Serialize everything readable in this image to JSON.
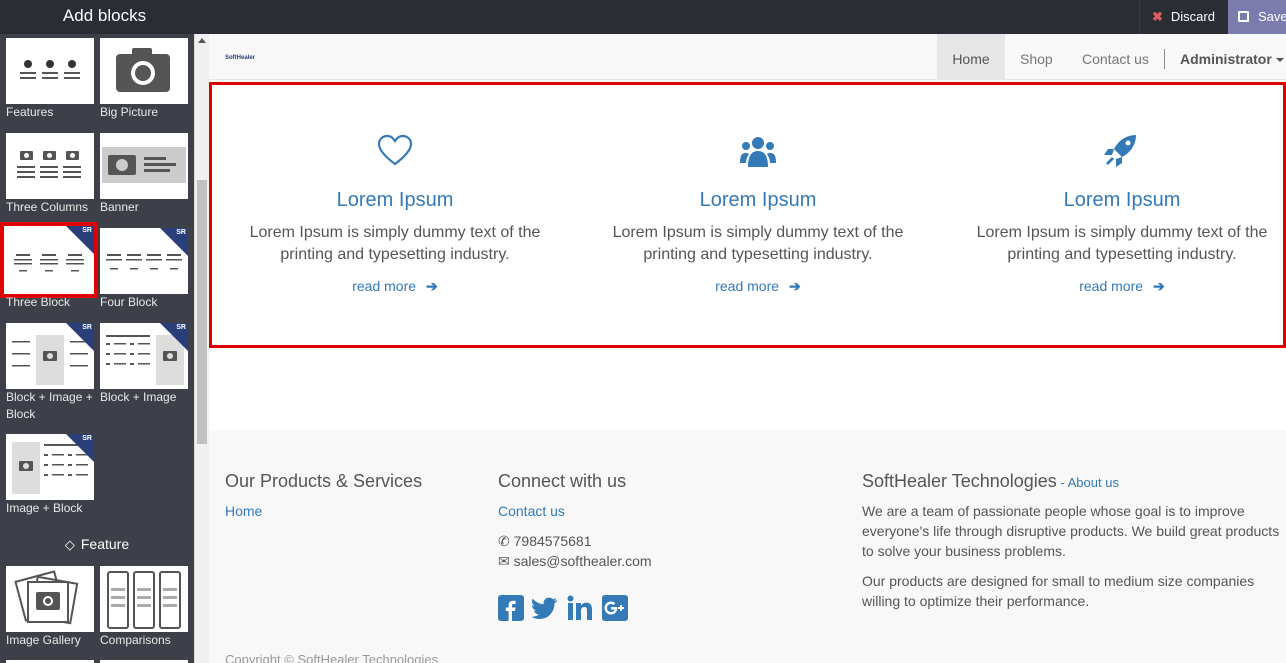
{
  "topbar": {
    "title": "Add blocks",
    "discard_label": "Discard",
    "save_label": "Save"
  },
  "sidebar": {
    "snippets": [
      {
        "label": "Features"
      },
      {
        "label": "Big Picture"
      },
      {
        "label": "Three Columns"
      },
      {
        "label": "Banner"
      },
      {
        "label": "Three Block"
      },
      {
        "label": "Four Block"
      },
      {
        "label": "Block + Image + Block"
      },
      {
        "label": "Block + Image"
      },
      {
        "label": "Image + Block"
      },
      {
        "label": "Image Gallery"
      },
      {
        "label": "Comparisons"
      }
    ],
    "badge_text": "SR",
    "feature_heading": "Feature"
  },
  "navbar": {
    "logo_text": "SoftHealer",
    "items": [
      {
        "label": "Home",
        "active": true
      },
      {
        "label": "Shop"
      },
      {
        "label": "Contact us"
      }
    ],
    "user_menu": "Administrator"
  },
  "three_block": {
    "columns": [
      {
        "icon": "heart-icon",
        "heading": "Lorem Ipsum",
        "text_line1": "Lorem Ipsum is simply dummy text of the",
        "text_line2": "printing and typesetting industry.",
        "link": "read more"
      },
      {
        "icon": "users-icon",
        "heading": "Lorem Ipsum",
        "text_line1": "Lorem Ipsum is simply dummy text of the",
        "text_line2": "printing and typesetting industry.",
        "link": "read more"
      },
      {
        "icon": "rocket-icon",
        "heading": "Lorem Ipsum",
        "text_line1": "Lorem Ipsum is simply dummy text of the",
        "text_line2": "printing and typesetting industry.",
        "link": "read more"
      }
    ],
    "accent_color": "#337ab7",
    "selection_color": "#e00000"
  },
  "footer": {
    "products": {
      "heading": "Our Products & Services",
      "link": "Home"
    },
    "connect": {
      "heading": "Connect with us",
      "link": "Contact us",
      "phone": "7984575681",
      "email": "sales@softhealer.com",
      "social_icons": [
        "facebook-icon",
        "twitter-icon",
        "linkedin-icon",
        "google-plus-icon"
      ]
    },
    "about": {
      "heading": "SoftHealer Technologies",
      "about_link": "About us",
      "para1_l1": "We are a team of passionate people whose goal is to improve",
      "para1_l2": "everyone's life through disruptive products. We build great products",
      "para1_l3": "to solve your business problems.",
      "para2_l1": "Our products are designed for small to medium size companies",
      "para2_l2": "willing to optimize their performance."
    },
    "copyright": "Copyright © SoftHealer Technologies"
  }
}
